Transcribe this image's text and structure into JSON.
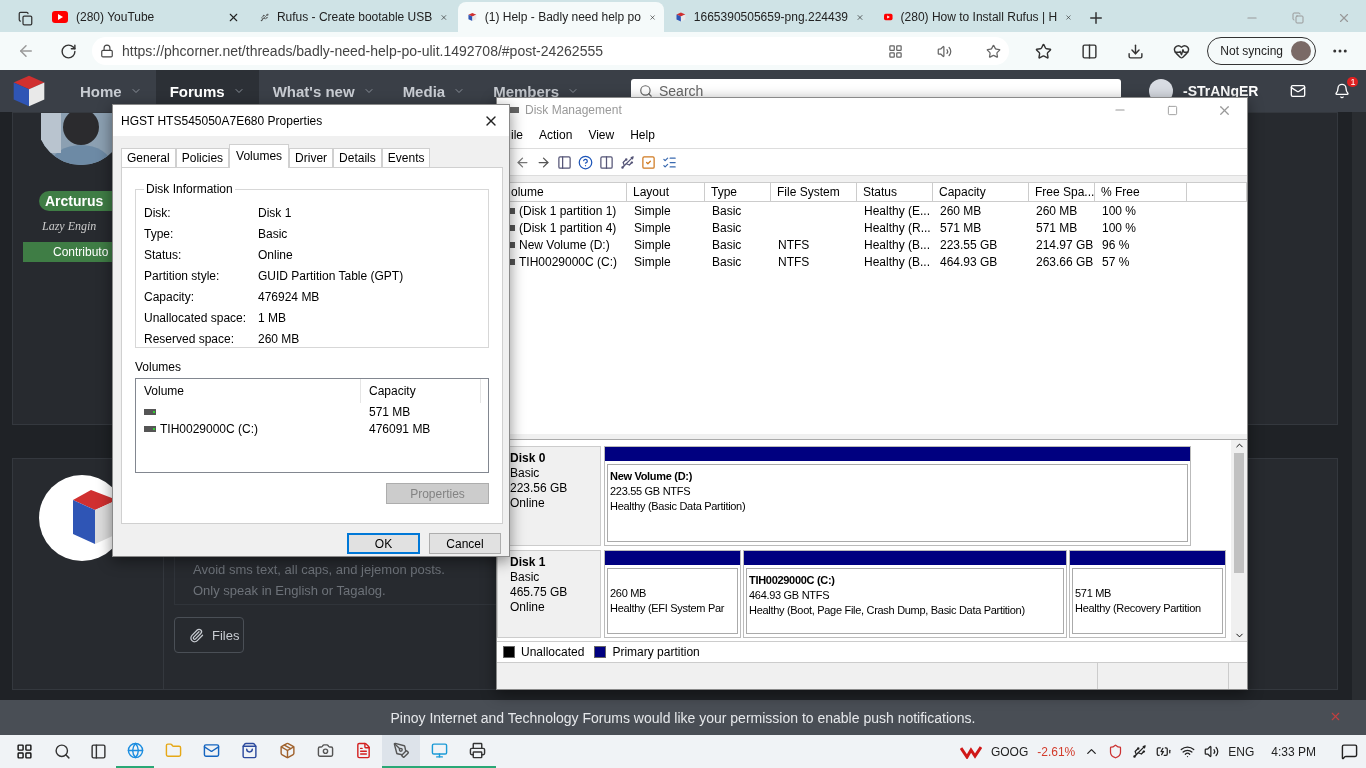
{
  "browser": {
    "tabs": [
      {
        "kind": "video",
        "title": "(280) YouTube",
        "selected": false
      },
      {
        "kind": "usb",
        "title": "Rufus - Create bootable USB",
        "selected": false
      },
      {
        "kind": "cube",
        "title": "(1) Help - Badly need help po",
        "selected": true
      },
      {
        "kind": "cube",
        "title": "1665390505659-png.224439",
        "selected": false
      },
      {
        "kind": "video",
        "title": "(280) How to Install Rufus | H",
        "selected": false
      }
    ],
    "url": "https://phcorner.net/threads/badly-need-help-po-ulit.1492708/#post-24262555",
    "sync_label": "Not syncing"
  },
  "forum": {
    "nav": [
      {
        "label": "Home",
        "selected": false
      },
      {
        "label": "Forums",
        "selected": true
      },
      {
        "label": "What's new",
        "selected": false
      },
      {
        "label": "Media",
        "selected": false
      },
      {
        "label": "Members",
        "selected": false
      }
    ],
    "search_placeholder": "Search",
    "username": "-STrANgER",
    "alert_count": "1",
    "author": {
      "name": "Arcturus",
      "title": "Lazy Engin",
      "banner": "Contributo"
    },
    "rules": [
      "Avoid sms text, all caps, and jejemon posts.",
      "Only speak in English or Tagalog."
    ],
    "files_button": "Files",
    "push_message": "Pinoy Internet and Technology Forums would like your permission to enable push notifications."
  },
  "disk_management": {
    "title": "Disk Management",
    "menu": [
      "ile",
      "Action",
      "View",
      "Help"
    ],
    "columns": [
      "olume",
      "Layout",
      "Type",
      "File System",
      "Status",
      "Capacity",
      "Free Spa...",
      "% Free"
    ],
    "rows": [
      [
        "(Disk 1 partition 1)",
        "Simple",
        "Basic",
        "",
        "Healthy (E...",
        "260 MB",
        "260 MB",
        "100 %"
      ],
      [
        "(Disk 1 partition 4)",
        "Simple",
        "Basic",
        "",
        "Healthy (R...",
        "571 MB",
        "571 MB",
        "100 %"
      ],
      [
        "New Volume (D:)",
        "Simple",
        "Basic",
        "NTFS",
        "Healthy (B...",
        "223.55 GB",
        "214.97 GB",
        "96 %"
      ],
      [
        "TIH0029000C (C:)",
        "Simple",
        "Basic",
        "NTFS",
        "Healthy (B...",
        "464.93 GB",
        "263.66 GB",
        "57 %"
      ]
    ],
    "disks": [
      {
        "name": "Disk 0",
        "type": "Basic",
        "size": "223.56 GB",
        "status": "Online",
        "partitions": [
          {
            "name": "New Volume  (D:)",
            "size": "223.55 GB NTFS",
            "status": "Healthy (Basic Data Partition)"
          }
        ]
      },
      {
        "name": "Disk 1",
        "type": "Basic",
        "size": "465.75 GB",
        "status": "Online",
        "partitions": [
          {
            "size": "260 MB",
            "status": "Healthy (EFI System Par"
          },
          {
            "name": "TIH0029000C  (C:)",
            "size": "464.93 GB NTFS",
            "status": "Healthy (Boot, Page File, Crash Dump, Basic Data Partition)"
          },
          {
            "size": "571 MB",
            "status": "Healthy (Recovery Partition"
          }
        ]
      }
    ],
    "legend": [
      {
        "label": "Unallocated",
        "color": "#000000"
      },
      {
        "label": "Primary partition",
        "color": "#000080"
      }
    ]
  },
  "properties": {
    "title": "HGST HTS545050A7E680 Properties",
    "tabs": [
      {
        "label": "General",
        "selected": false
      },
      {
        "label": "Policies",
        "selected": false
      },
      {
        "label": "Volumes",
        "selected": true
      },
      {
        "label": "Driver",
        "selected": false
      },
      {
        "label": "Details",
        "selected": false
      },
      {
        "label": "Events",
        "selected": false
      }
    ],
    "group_title": "Disk Information",
    "info": [
      {
        "label": "Disk:",
        "value": "Disk 1"
      },
      {
        "label": "Type:",
        "value": "Basic"
      },
      {
        "label": "Status:",
        "value": "Online"
      },
      {
        "label": "Partition style:",
        "value": "GUID Partition Table (GPT)"
      },
      {
        "label": "Capacity:",
        "value": "476924 MB"
      },
      {
        "label": "Unallocated space:",
        "value": "1 MB"
      },
      {
        "label": "Reserved space:",
        "value": "260 MB"
      }
    ],
    "volumes_label": "Volumes",
    "volume_columns": [
      "Volume",
      "Capacity"
    ],
    "volumes": [
      {
        "capacity": "571 MB"
      },
      {
        "name": "TIH0029000C (C:)",
        "capacity": "476091 MB"
      }
    ],
    "properties_button": {
      "label": "Properties",
      "disabled": true
    },
    "ok_button": {
      "label": "OK",
      "default": true
    },
    "cancel_button": {
      "label": "Cancel"
    }
  },
  "taskbar": {
    "apps": [
      {
        "kind": "edge",
        "running": true,
        "selected": false
      },
      {
        "kind": "folder",
        "running": false,
        "selected": false
      },
      {
        "kind": "mail",
        "running": false,
        "selected": false
      },
      {
        "kind": "store",
        "running": false,
        "selected": false
      },
      {
        "kind": "archive",
        "running": false,
        "selected": false
      },
      {
        "kind": "camera",
        "running": false,
        "selected": false
      },
      {
        "kind": "reader",
        "running": false,
        "selected": false
      },
      {
        "kind": "pen",
        "running": true,
        "selected": true
      },
      {
        "kind": "screen",
        "running": true,
        "selected": false
      },
      {
        "kind": "printer",
        "running": true,
        "selected": false
      }
    ],
    "stock_symbol": "GOOG",
    "stock_change": "-2.61%",
    "language": "ENG",
    "time": "4:33 PM"
  }
}
